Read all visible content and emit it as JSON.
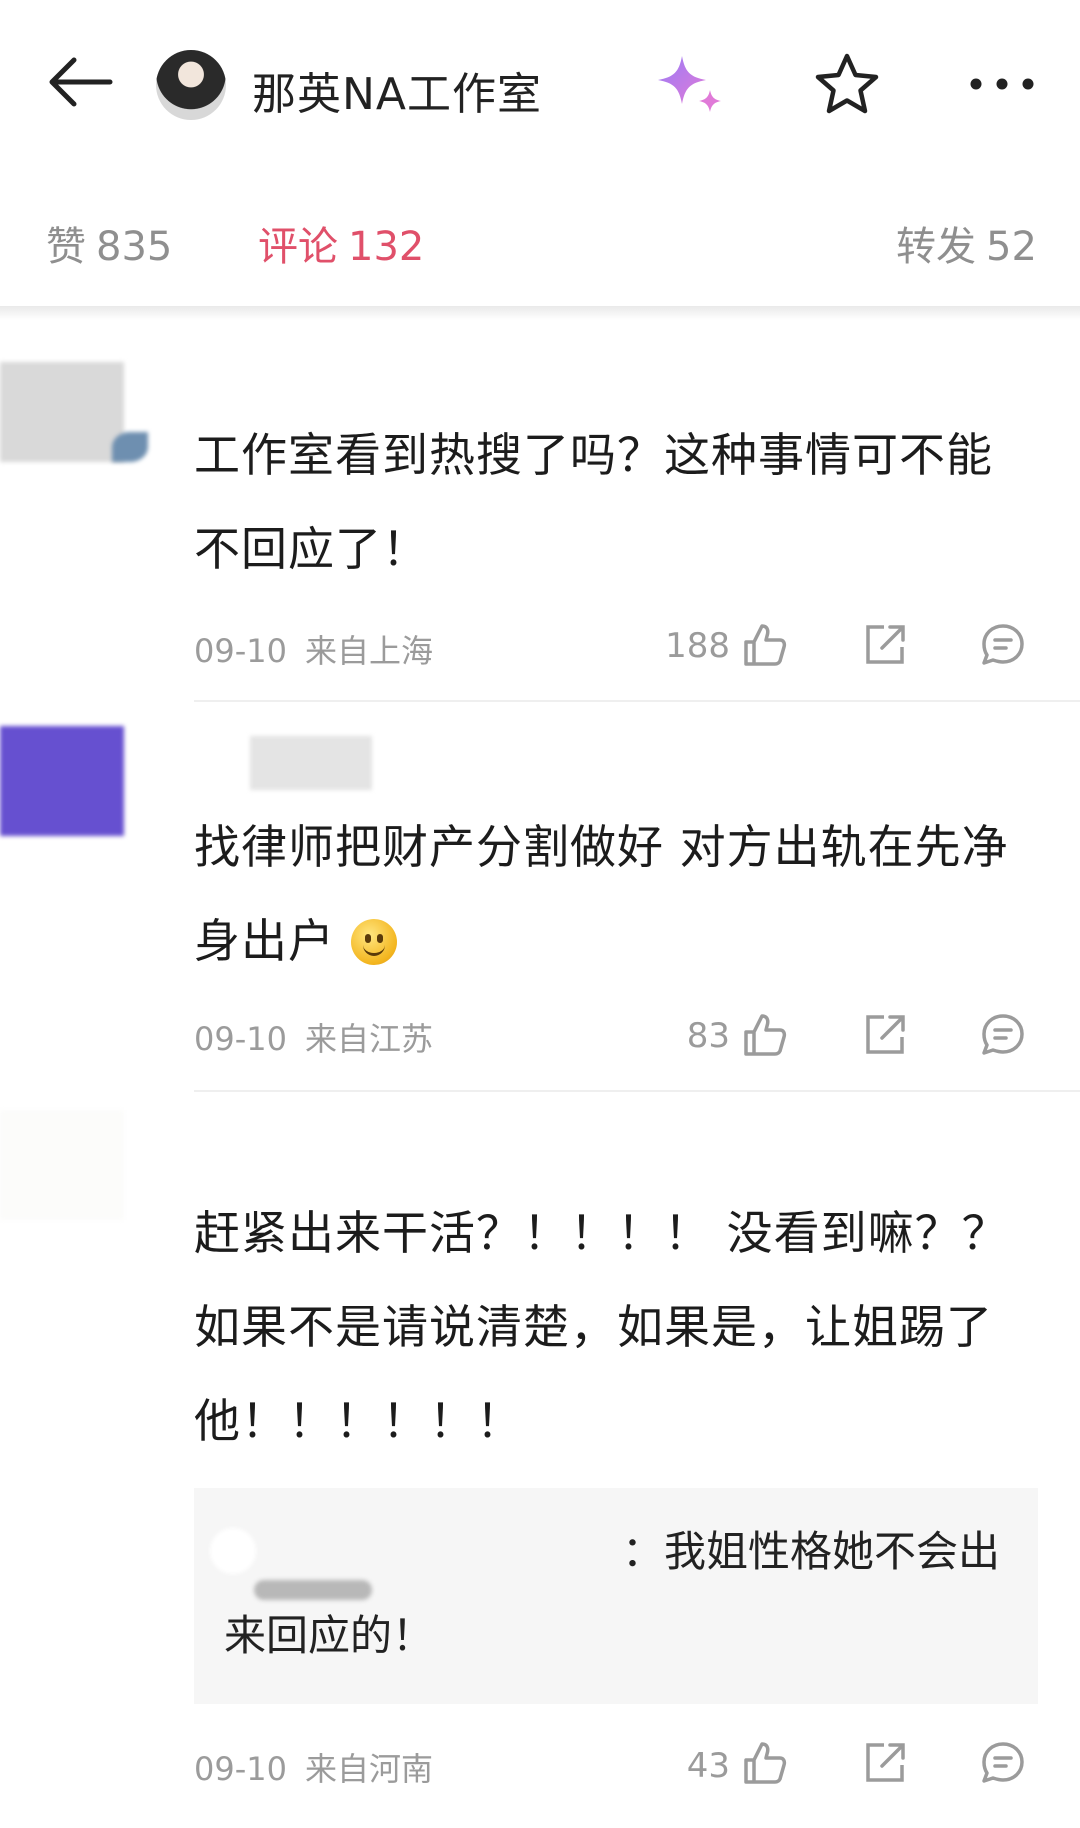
{
  "header": {
    "title": "那英NA工作室",
    "icons": [
      "back-arrow-icon",
      "avatar",
      "sparkle-icon",
      "star-icon",
      "more-icon"
    ]
  },
  "tabs": {
    "likes_label": "赞",
    "likes_count": "835",
    "comments_label": "评论",
    "comments_count": "132",
    "reposts_label": "转发",
    "reposts_count": "52"
  },
  "colors": {
    "accent": "#e0506a",
    "muted": "#9b9b9b",
    "reply_bg": "#f6f6f6",
    "sparkle_a": "#9b7cf6",
    "sparkle_b": "#e07ad8"
  },
  "comments": [
    {
      "text": "工作室看到热搜了吗？这种事情可不能不回应了！",
      "date": "09-10",
      "location": "来自上海",
      "likes": "188"
    },
    {
      "text": "找律师把财产分割做好 对方出轨在先净身出户",
      "emoji": "smile-emoji",
      "date": "09-10",
      "location": "来自江苏",
      "likes": "83"
    },
    {
      "text": "赶紧出来干活？！！！！ 没看到嘛？？如果不是请说清楚，如果是，让姐踢了他！！！！！！",
      "reply": {
        "text": "：我姐性格她不会出来回应的！"
      },
      "date": "09-10",
      "location": "来自河南",
      "likes": "43"
    }
  ]
}
